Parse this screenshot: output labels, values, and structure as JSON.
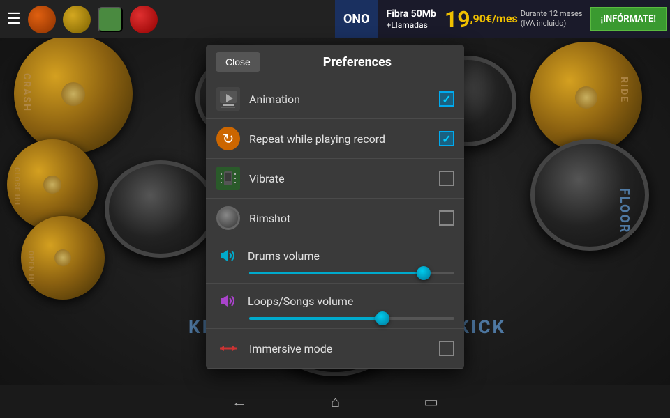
{
  "topbar": {
    "hamburger": "☰",
    "buttons": [
      "record",
      "settings",
      "green",
      "red"
    ]
  },
  "ad": {
    "brand": "ONO",
    "line1": "Fibra 50Mb",
    "line2": "+Llamadas",
    "price_big": "19",
    "price_decimal": ",90€/mes",
    "price_note1": "Durante 12 meses",
    "price_note2": "(IVA incluido)",
    "cta": "¡INFÓRMATE!"
  },
  "dialog": {
    "close_label": "Close",
    "title": "Preferences",
    "items": [
      {
        "id": "animation",
        "label": "Animation",
        "checked": true
      },
      {
        "id": "repeat",
        "label": "Repeat while playing record",
        "checked": true
      },
      {
        "id": "vibrate",
        "label": "Vibrate",
        "checked": false
      },
      {
        "id": "rimshot",
        "label": "Rimshot",
        "checked": false
      }
    ],
    "sliders": [
      {
        "id": "drums_volume",
        "label": "Drums volume",
        "value": 85,
        "fill_percent": 85
      },
      {
        "id": "loops_volume",
        "label": "Loops/Songs volume",
        "value": 65,
        "fill_percent": 65
      }
    ],
    "immersive": {
      "label": "Immersive mode",
      "checked": false
    }
  },
  "drums": {
    "kick_label_l": "KICK",
    "kick_label_r": "KICK",
    "crash_label": "CRASH",
    "ride_label": "RIDE",
    "closehh_label": "CLOSE HH",
    "openhh_label": "OPEN HH",
    "floor_label": "FLOOR"
  },
  "bottomnav": {
    "back": "←",
    "home": "⌂",
    "recents": "▭"
  }
}
